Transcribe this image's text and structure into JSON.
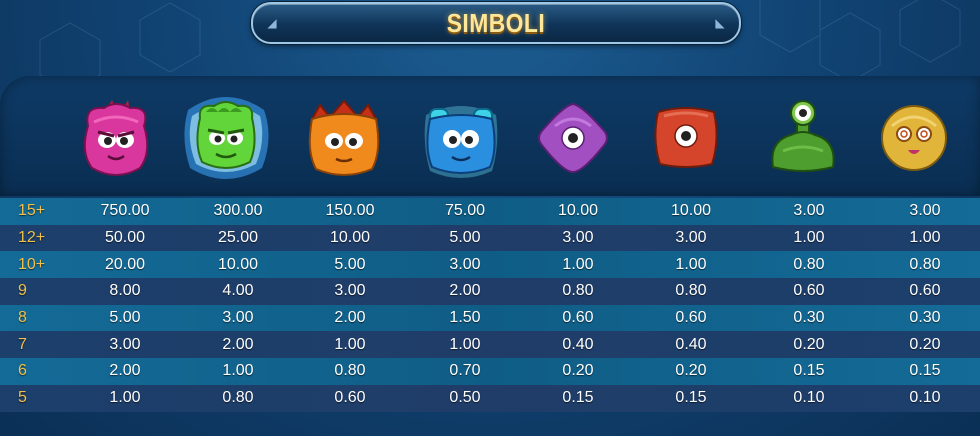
{
  "title": "SIMBOLI",
  "symbols": [
    {
      "icon": "pink-horned-monster-icon",
      "color": "#e23fa8"
    },
    {
      "icon": "green-glowing-monster-icon",
      "color": "#5fd23c"
    },
    {
      "icon": "orange-crowned-monster-icon",
      "color": "#f08a1c"
    },
    {
      "icon": "blue-monster-icon",
      "color": "#2b8fe0"
    },
    {
      "icon": "purple-diamond-eye-icon",
      "color": "#a24fc2"
    },
    {
      "icon": "red-square-eye-icon",
      "color": "#d4452b"
    },
    {
      "icon": "green-slime-eye-icon",
      "color": "#4d9d2f"
    },
    {
      "icon": "yellow-ball-monster-icon",
      "color": "#e1b43a"
    }
  ],
  "paytable": [
    {
      "count": "15+",
      "values": [
        "750.00",
        "300.00",
        "150.00",
        "75.00",
        "10.00",
        "10.00",
        "3.00",
        "3.00"
      ]
    },
    {
      "count": "12+",
      "values": [
        "50.00",
        "25.00",
        "10.00",
        "5.00",
        "3.00",
        "3.00",
        "1.00",
        "1.00"
      ]
    },
    {
      "count": "10+",
      "values": [
        "20.00",
        "10.00",
        "5.00",
        "3.00",
        "1.00",
        "1.00",
        "0.80",
        "0.80"
      ]
    },
    {
      "count": "9",
      "values": [
        "8.00",
        "4.00",
        "3.00",
        "2.00",
        "0.80",
        "0.80",
        "0.60",
        "0.60"
      ]
    },
    {
      "count": "8",
      "values": [
        "5.00",
        "3.00",
        "2.00",
        "1.50",
        "0.60",
        "0.60",
        "0.30",
        "0.30"
      ]
    },
    {
      "count": "7",
      "values": [
        "3.00",
        "2.00",
        "1.00",
        "1.00",
        "0.40",
        "0.40",
        "0.20",
        "0.20"
      ]
    },
    {
      "count": "6",
      "values": [
        "2.00",
        "1.00",
        "0.80",
        "0.70",
        "0.20",
        "0.20",
        "0.15",
        "0.15"
      ]
    },
    {
      "count": "5",
      "values": [
        "1.00",
        "0.80",
        "0.60",
        "0.50",
        "0.15",
        "0.15",
        "0.10",
        "0.10"
      ]
    }
  ]
}
